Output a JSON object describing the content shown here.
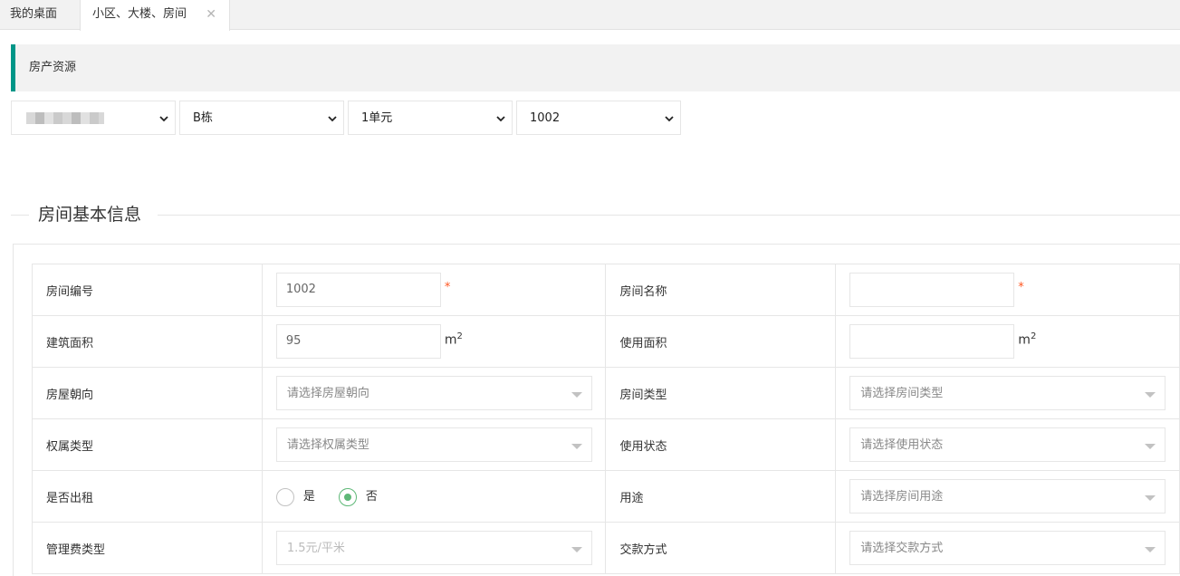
{
  "tabs": [
    {
      "label": "我的桌面"
    },
    {
      "label": "小区、大楼、房间",
      "close": "✕"
    }
  ],
  "section_title": "房产资源",
  "selects": {
    "community": "",
    "building": "B栋",
    "unit": "1单元",
    "room": "1002"
  },
  "fieldset_title": "房间基本信息",
  "form": {
    "room_no": {
      "label": "房间编号",
      "value": "1002",
      "required": "*"
    },
    "room_name": {
      "label": "房间名称",
      "value": "",
      "required": "*"
    },
    "build_area": {
      "label": "建筑面积",
      "value": "95",
      "unit": "m",
      "unit_sup": "2"
    },
    "use_area": {
      "label": "使用面积",
      "value": "",
      "unit": "m",
      "unit_sup": "2"
    },
    "orientation": {
      "label": "房屋朝向",
      "placeholder": "请选择房屋朝向"
    },
    "room_type": {
      "label": "房间类型",
      "placeholder": "请选择房间类型"
    },
    "ownership": {
      "label": "权属类型",
      "placeholder": "请选择权属类型"
    },
    "use_status": {
      "label": "使用状态",
      "placeholder": "请选择使用状态"
    },
    "rented": {
      "label": "是否出租",
      "yes": "是",
      "no": "否",
      "selected": "否"
    },
    "purpose": {
      "label": "用途",
      "placeholder": "请选择房间用途"
    },
    "mgmt_fee": {
      "label": "管理费类型",
      "value": "1.5元/平米"
    },
    "payment": {
      "label": "交款方式",
      "placeholder": "请选择交款方式"
    }
  },
  "colors": {
    "accent": "#009688",
    "radio": "#5fb878",
    "required": "#ff5722"
  }
}
